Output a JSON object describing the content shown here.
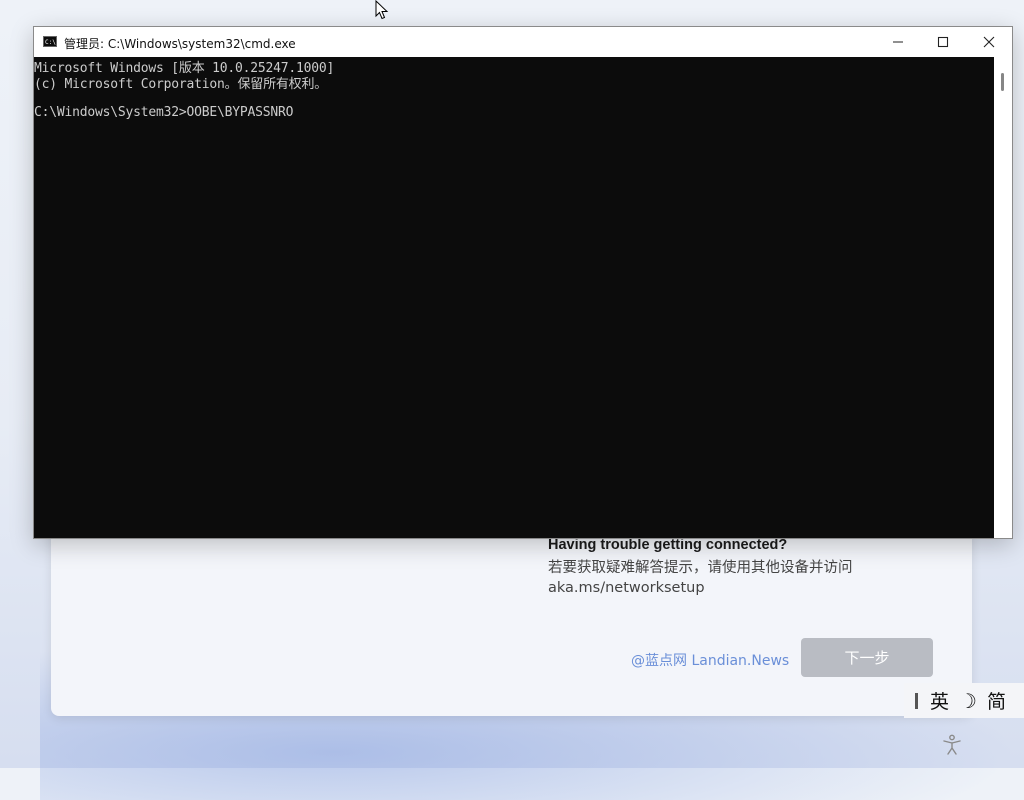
{
  "cmd": {
    "title": "管理员: C:\\Windows\\system32\\cmd.exe",
    "icon_text": "C:\\",
    "lines": [
      "Microsoft Windows [版本 10.0.25247.1000]",
      "(c) Microsoft Corporation。保留所有权利。",
      "",
      "C:\\Windows\\System32>OOBE\\BYPASSNRO"
    ],
    "icons": {
      "minimize": "minimize-icon",
      "maximize": "maximize-icon",
      "close": "close-icon"
    }
  },
  "oobe": {
    "help_title": "Having trouble getting connected?",
    "help_text": "若要获取疑难解答提示，请使用其他设备并访问 aka.ms/networksetup",
    "watermark": "@蓝点网 Landian.News",
    "next_label": "下一步"
  },
  "ime": {
    "mode": "英",
    "moon": "☽",
    "charset": "简"
  },
  "colors": {
    "console_bg": "#0c0c0c",
    "console_fg": "#cccccc",
    "next_button": "#b9bcc3",
    "watermark": "#6a8fd8"
  }
}
